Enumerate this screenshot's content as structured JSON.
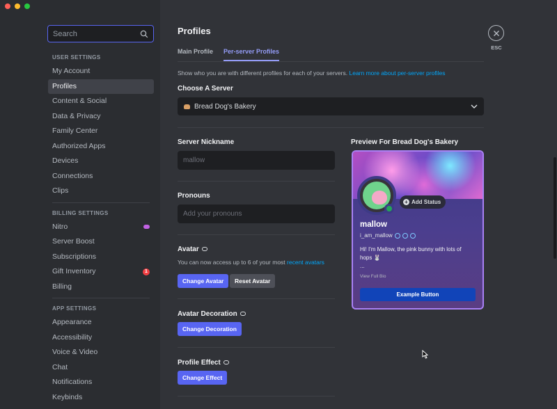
{
  "sidebar": {
    "search_placeholder": "Search",
    "sections": [
      {
        "header": "USER SETTINGS",
        "items": [
          {
            "label": "My Account"
          },
          {
            "label": "Profiles",
            "active": true
          },
          {
            "label": "Content & Social"
          },
          {
            "label": "Data & Privacy"
          },
          {
            "label": "Family Center"
          },
          {
            "label": "Authorized Apps"
          },
          {
            "label": "Devices"
          },
          {
            "label": "Connections"
          },
          {
            "label": "Clips"
          }
        ]
      },
      {
        "header": "BILLING SETTINGS",
        "items": [
          {
            "label": "Nitro",
            "icon": "nitro-icon"
          },
          {
            "label": "Server Boost"
          },
          {
            "label": "Subscriptions"
          },
          {
            "label": "Gift Inventory",
            "badge": "1"
          },
          {
            "label": "Billing"
          }
        ]
      },
      {
        "header": "APP SETTINGS",
        "items": [
          {
            "label": "Appearance"
          },
          {
            "label": "Accessibility"
          },
          {
            "label": "Voice & Video"
          },
          {
            "label": "Chat"
          },
          {
            "label": "Notifications"
          },
          {
            "label": "Keybinds"
          }
        ]
      }
    ]
  },
  "header": {
    "title": "Profiles",
    "esc_label": "ESC",
    "tabs": [
      {
        "label": "Main Profile"
      },
      {
        "label": "Per-server Profiles",
        "active": true
      }
    ]
  },
  "main": {
    "description": "Show who you are with different profiles for each of your servers.",
    "description_link": "Learn more about per-server profiles",
    "choose_server_title": "Choose A Server",
    "selected_server": "Bread Dog's Bakery",
    "nickname_title": "Server Nickname",
    "nickname_placeholder": "mallow",
    "pronouns_title": "Pronouns",
    "pronouns_placeholder": "Add your pronouns",
    "avatar_title": "Avatar",
    "avatar_sub": "You can now access up to 6 of your most",
    "avatar_sub_link": "recent avatars",
    "change_avatar": "Change Avatar",
    "reset_avatar": "Reset Avatar",
    "decoration_title": "Avatar Decoration",
    "change_decoration": "Change Decoration",
    "effect_title": "Profile Effect",
    "change_effect": "Change Effect"
  },
  "preview": {
    "title": "Preview For Bread Dog's Bakery",
    "add_status": "Add Status",
    "name": "mallow",
    "username": "i_am_mallow",
    "bio_line1": "Hi! I'm Mallow, the pink bunny with lots of",
    "bio_line2": "hops 🐰",
    "bio_more": "...",
    "view_full_bio": "View Full Bio",
    "example_button": "Example Button"
  },
  "colors": {
    "accent": "#5865f2",
    "link": "#00a8fc",
    "card_border": "#a981f5",
    "status_online": "#23a55a"
  }
}
